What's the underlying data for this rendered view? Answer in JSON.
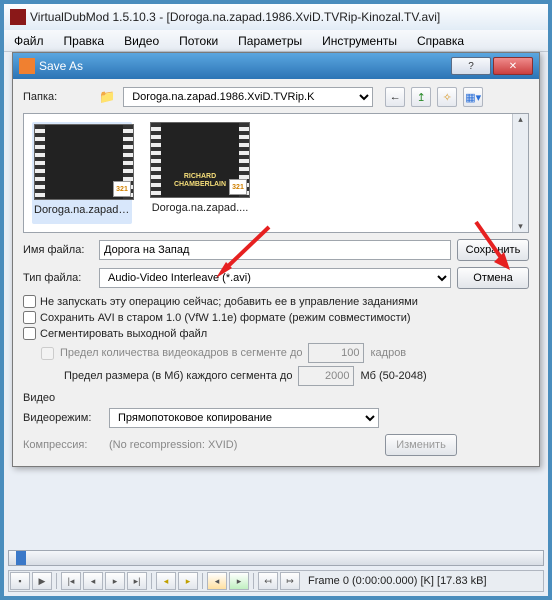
{
  "window": {
    "title": "VirtualDubMod 1.5.10.3 - [Doroga.na.zapad.1986.XviD.TVRip-Kinozal.TV.avi]"
  },
  "menu": [
    "Файл",
    "Правка",
    "Видео",
    "Потоки",
    "Параметры",
    "Инструменты",
    "Справка"
  ],
  "dialog": {
    "title": "Save As",
    "folder_label": "Папка:",
    "folder_value": "Doroga.na.zapad.1986.XviD.TVRip.K",
    "files": [
      {
        "name": "Doroga.na.zapad...."
      },
      {
        "name": "Doroga.na.zapad...."
      }
    ],
    "thumb2_text": "RICHARD CHAMBERLAIN",
    "badge_text": "321",
    "filename_label": "Имя файла:",
    "filename_value": "Дорога на Запад",
    "filetype_label": "Тип файла:",
    "filetype_value": "Audio-Video Interleave (*.avi)",
    "save_btn": "Сохранить",
    "cancel_btn": "Отмена",
    "chk_defer": "Не запускать эту операцию сейчас; добавить ее в управление заданиями",
    "chk_oldavi": "Сохранить AVI в старом 1.0 (VfW 1.1e) формате (режим совместимости)",
    "chk_segment": "Сегментировать выходной файл",
    "seg_frames_label": "Предел количества видеокадров в сегменте до",
    "seg_frames_value": "100",
    "seg_frames_suffix": "кадров",
    "seg_size_label": "Предел размера (в Мб) каждого сегмента до",
    "seg_size_value": "2000",
    "seg_size_suffix": "Мб (50-2048)",
    "video_header": "Видео",
    "videomode_label": "Видеорежим:",
    "videomode_value": "Прямопотоковое копирование",
    "compression_label": "Компрессия:",
    "compression_value": "(No recompression: XVID)",
    "change_btn": "Изменить"
  },
  "status": {
    "frame": "Frame 0 (0:00:00.000) [K] [17.83 kB]"
  }
}
